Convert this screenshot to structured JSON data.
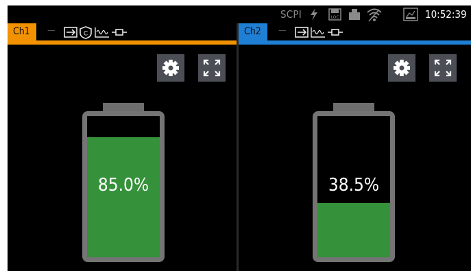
{
  "status_bar": {
    "scpi_label": "SCPI",
    "time": "10:52:39",
    "icons": [
      "lightning-icon",
      "loc-icon",
      "usb-drive-icon",
      "wifi-icon",
      "network-storage-icon"
    ]
  },
  "channels": [
    {
      "tab_label": "Ch1",
      "accent_color": "#f39200",
      "status_icons": [
        "output-icon",
        "copyright-protection-icon",
        "waveform-icon",
        "connector-icon"
      ],
      "settings_icon": "gear-icon",
      "fullscreen_icon": "expand-icon",
      "battery_level": 0.85,
      "battery_label": "85.0%"
    },
    {
      "tab_label": "Ch2",
      "accent_color": "#1f7fd4",
      "status_icons": [
        "output-icon",
        "waveform-icon",
        "connector-icon"
      ],
      "settings_icon": "gear-icon",
      "fullscreen_icon": "expand-icon",
      "battery_level": 0.385,
      "battery_label": "38.5%"
    }
  ],
  "colors": {
    "battery_fill": "#36913b",
    "battery_frame": "#747474",
    "button_bg": "#4b4f55"
  }
}
